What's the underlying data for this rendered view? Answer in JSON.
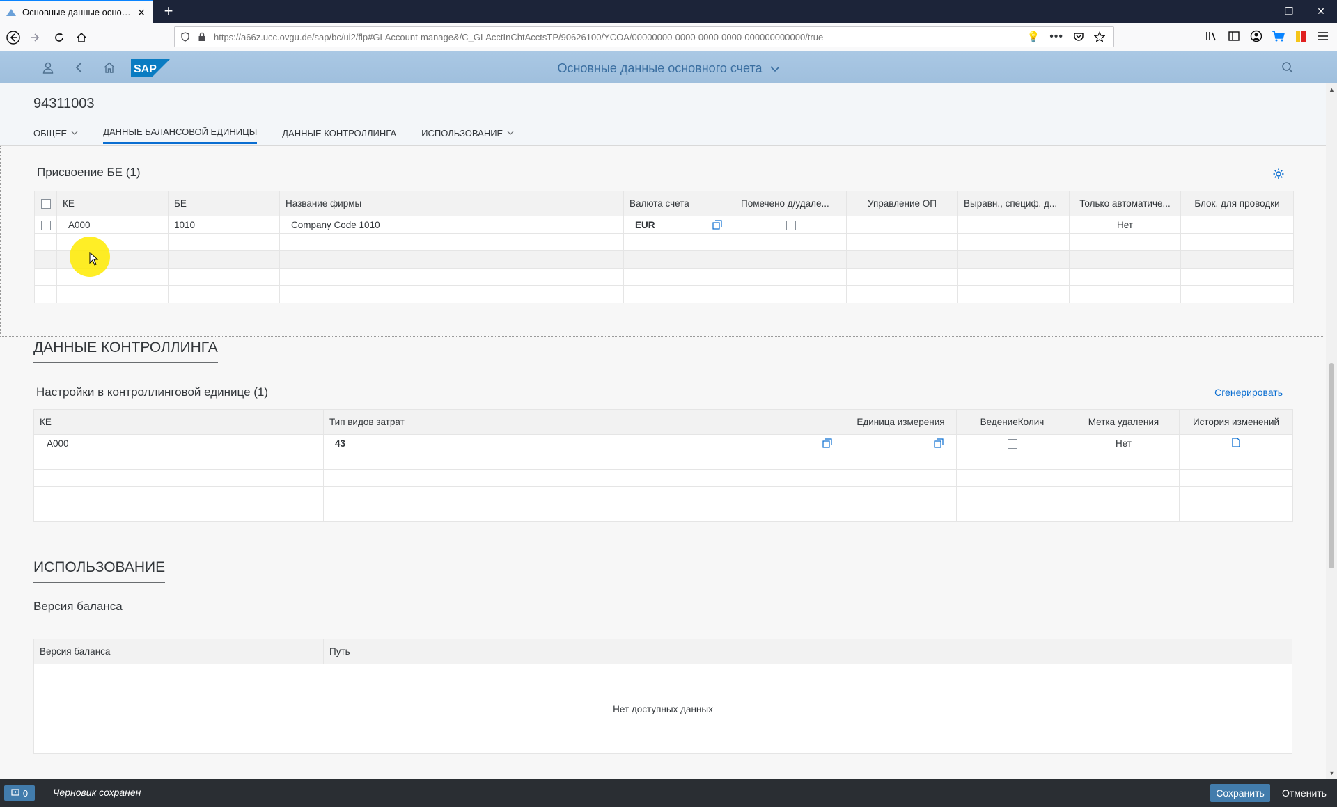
{
  "browser": {
    "tab_title": "Основные данные основного",
    "url": "https://a66z.ucc.ovgu.de/sap/bc/ui2/flp#GLAccount-manage&/C_GLAcctInChtAcctsTP/90626100/YCOA/00000000-0000-0000-0000-000000000000/true"
  },
  "shell": {
    "title": "Основные данные основного счета"
  },
  "header": {
    "object_title": "94311003",
    "anchors": [
      {
        "label": "ОБЩЕЕ"
      },
      {
        "label": "ДАННЫЕ БАЛАНСОВОЙ ЕДИНИЦЫ"
      },
      {
        "label": "ДАННЫЕ КОНТРОЛЛИНГА"
      },
      {
        "label": "ИСПОЛЬЗОВАНИЕ"
      }
    ]
  },
  "company_assignment": {
    "title": "Присвоение БЕ (1)",
    "columns": [
      "КЕ",
      "БЕ",
      "Название фирмы",
      "Валюта счета",
      "Помечено д/удале...",
      "Управление ОП",
      "Выравн., специф. д...",
      "Только автоматиче...",
      "Блок. для проводки"
    ],
    "rows": [
      {
        "ke": "A000",
        "be": "1010",
        "name": "Company Code 1010",
        "currency": "EUR",
        "auto_only": "Нет"
      }
    ]
  },
  "controlling": {
    "section_title": "ДАННЫЕ КОНТРОЛЛИНГА",
    "title": "Настройки в контроллинговой единице (1)",
    "generate_label": "Сгенерировать",
    "columns": [
      "КЕ",
      "Тип видов затрат",
      "Единица измерения",
      "ВедениеКолич",
      "Метка удаления",
      "История изменений"
    ],
    "rows": [
      {
        "ke": "A000",
        "cost_type": "43",
        "deletion_flag": "Нет"
      }
    ]
  },
  "usage": {
    "section_title": "ИСПОЛЬЗОВАНИЕ",
    "subtitle": "Версия баланса",
    "columns": [
      "Версия баланса",
      "Путь"
    ],
    "empty_text": "Нет доступных данных"
  },
  "footer": {
    "message_count": "0",
    "draft_status": "Черновик сохранен",
    "save_label": "Сохранить",
    "cancel_label": "Отменить"
  },
  "colors": {
    "shell": "#a8c6e2",
    "accent": "#0a6ed1",
    "footer": "#2a2e33",
    "emphasized_button": "#427cac"
  }
}
